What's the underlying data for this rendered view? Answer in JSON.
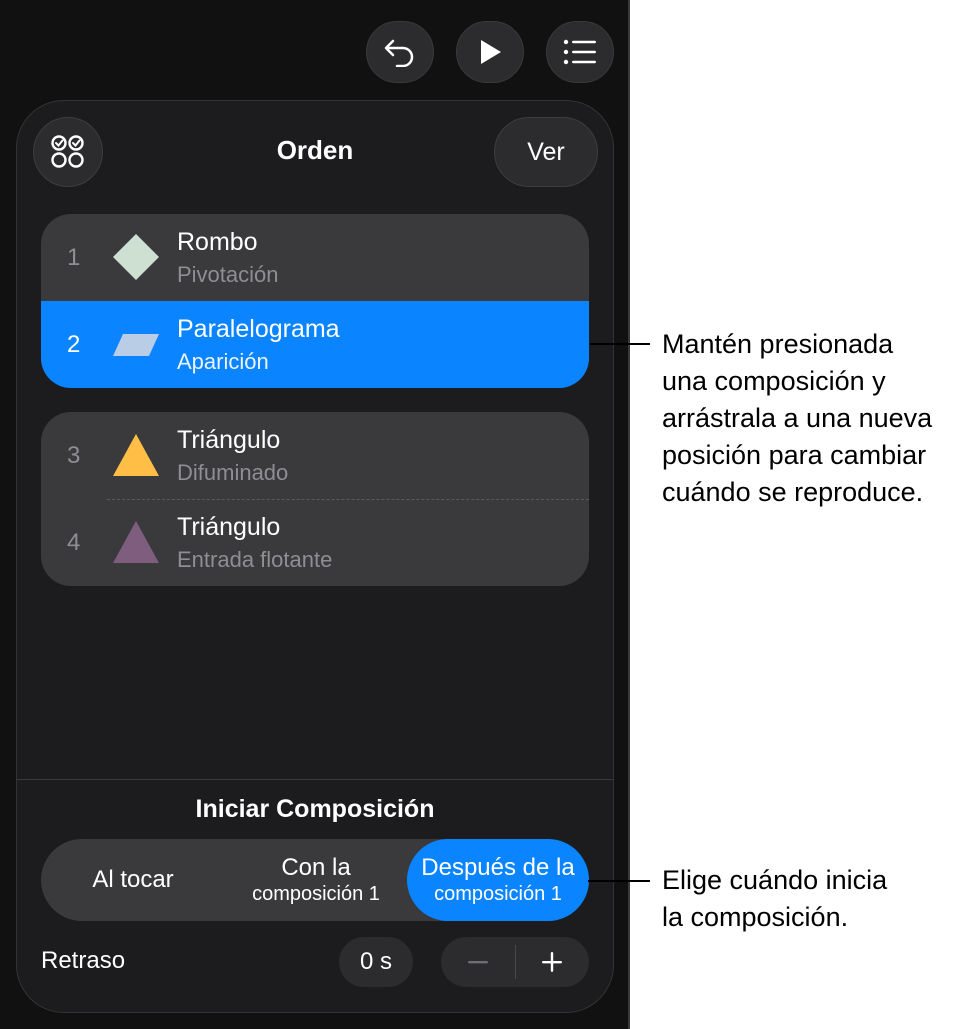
{
  "toolbar": {
    "undo_icon": "undo-arrow-icon",
    "play_icon": "play-icon",
    "list_icon": "list-icon"
  },
  "panel": {
    "title": "Orden",
    "view_button": "Ver",
    "select_icon": "multi-select-icon"
  },
  "builds": [
    {
      "number": "1",
      "title": "Rombo",
      "effect": "Pivotación",
      "shape": "diamond",
      "color": "#cde0d2",
      "selected": false
    },
    {
      "number": "2",
      "title": "Paralelograma",
      "effect": "Aparición",
      "shape": "parallelogram",
      "color": "#b9cde6",
      "selected": true
    },
    {
      "number": "3",
      "title": "Triángulo",
      "effect": "Difuminado",
      "shape": "triangle",
      "color": "#ffbe45",
      "selected": false
    },
    {
      "number": "4",
      "title": "Triángulo",
      "effect": "Entrada flotante",
      "shape": "triangle",
      "color": "#7f5d7e",
      "selected": false
    }
  ],
  "start": {
    "title": "Iniciar Composición",
    "options": [
      {
        "line1": "Al tocar",
        "line2": ""
      },
      {
        "line1": "Con la",
        "line2": "composición 1"
      },
      {
        "line1": "Después de la",
        "line2": "composición 1"
      }
    ],
    "selected_index": 2
  },
  "delay": {
    "label": "Retraso",
    "value": "0 s",
    "minus": "−",
    "plus": "+"
  },
  "callouts": {
    "reorder": [
      "Mantén presionada",
      "una composición y",
      "arrástrala a una nueva",
      "posición para cambiar",
      "cuándo se reproduce."
    ],
    "start": [
      "Elige cuándo inicia",
      "la composición."
    ]
  },
  "colors": {
    "accent": "#0a84ff",
    "panel_bg": "#1c1c1e",
    "group_bg": "#3a3a3c"
  }
}
